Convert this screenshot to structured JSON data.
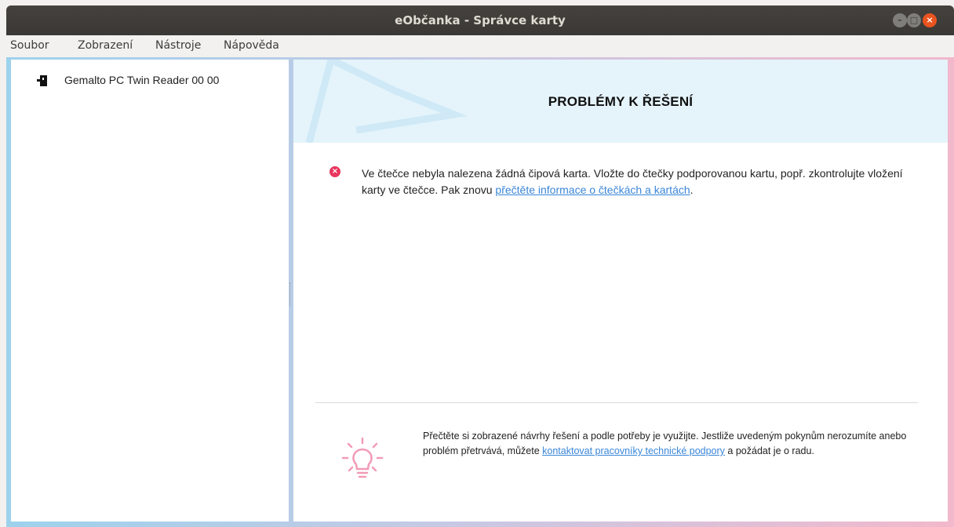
{
  "window": {
    "title": "eObčanka - Správce karty"
  },
  "menubar": {
    "items": [
      {
        "label": "Soubor"
      },
      {
        "label": "Zobrazení"
      },
      {
        "label": "Nástroje"
      },
      {
        "label": "Nápověda"
      }
    ]
  },
  "sidebar": {
    "reader": {
      "label": "Gemalto PC Twin Reader 00 00",
      "icon": "card-reader-icon"
    }
  },
  "main": {
    "banner_title": "PROBLÉMY K ŘEŠENÍ",
    "error": {
      "icon": "error-icon",
      "text_before": "Ve čtečce nebyla nalezena žádná čipová karta. Vložte do čtečky podporovanou kartu, popř. zkontrolujte vložení karty ve čtečce. Pak znovu ",
      "link": "přečtěte informace o čtečkách a kartách",
      "text_after": "."
    },
    "hint": {
      "icon": "lightbulb-icon",
      "text_before": "Přečtěte si zobrazené návrhy řešení a podle potřeby je využijte. Jestliže uvedeným pokynům nerozumíte anebo problém přetrvává, můžete ",
      "link": "kontaktovat pracovníky technické podpory",
      "text_after": " a požádat je o radu."
    }
  },
  "colors": {
    "accent_link": "#3a86d8",
    "error_red": "#e8365d",
    "banner_bg": "#e5f4fb",
    "hint_pink": "#f29bb6"
  }
}
